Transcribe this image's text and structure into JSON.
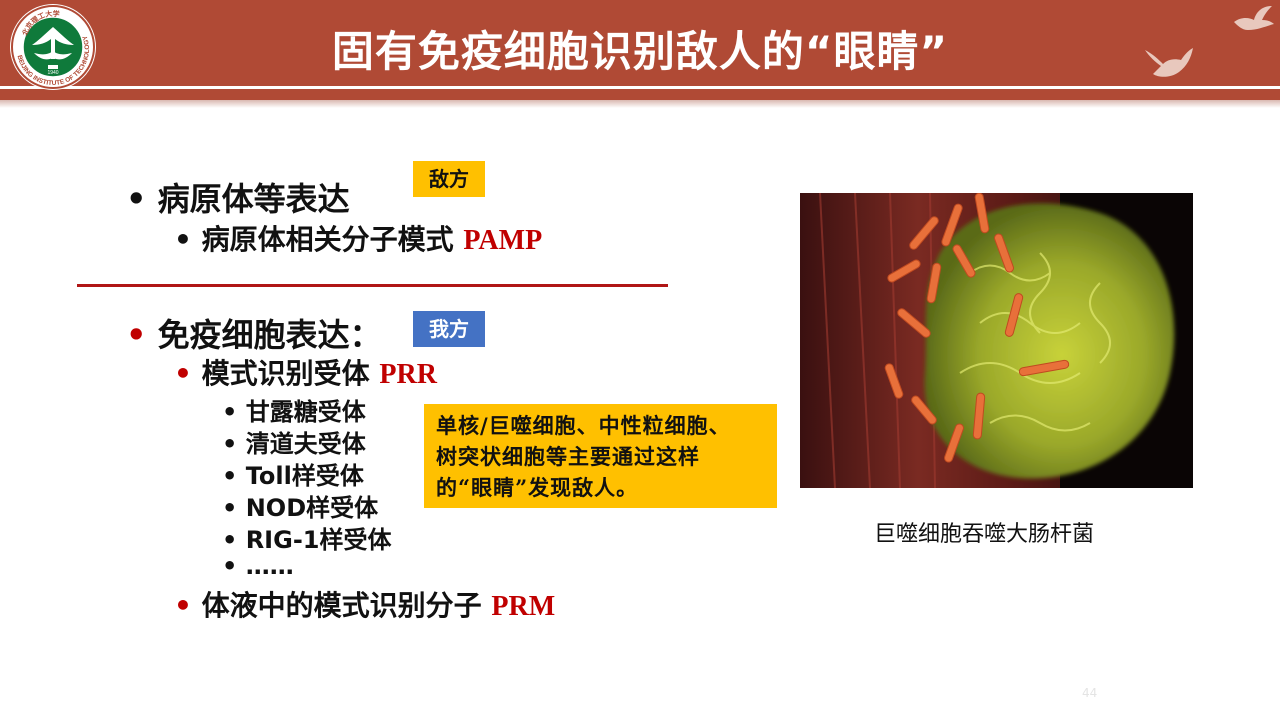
{
  "header": {
    "title": "固有免疫细胞识别敌人的“眼睛”",
    "logo_ring_text": "BEIJING INSTITUTE OF TECHNOLOGY",
    "logo_top_text": "北京理工大学",
    "logo_year": "1940"
  },
  "content": {
    "pathogen": {
      "bullet": "•",
      "heading": "病原体等表达",
      "tag": "敌方",
      "sub_bullet": "•",
      "sub_text": "病原体相关分子模式 ",
      "sub_abbr": "PAMP"
    },
    "immune": {
      "bullet": "•",
      "heading": "免疫细胞表达：",
      "tag": "我方",
      "prr_bullet": "•",
      "prr_text": "模式识别受体 ",
      "prr_abbr": "PRR",
      "receptors": [
        {
          "bullet": "•",
          "text": "甘露糖受体"
        },
        {
          "bullet": "•",
          "text": "清道夫受体"
        },
        {
          "bullet": "•",
          "text": "Toll样受体"
        },
        {
          "bullet": "•",
          "text": "NOD样受体"
        },
        {
          "bullet": "•",
          "text": "RIG-1样受体"
        },
        {
          "bullet": "•",
          "text": "……"
        }
      ],
      "prm_bullet": "•",
      "prm_text": "体液中的模式识别分子 ",
      "prm_abbr": "PRM"
    },
    "note_lines": [
      "单核/巨噬细胞、中性粒细胞、",
      "树突状细胞等主要通过这样",
      "的“眼睛”发现敌人。"
    ],
    "photo_caption": "巨噬细胞吞噬大肠杆菌",
    "page_number": "44"
  },
  "colors": {
    "header": "#b04a35",
    "accent_red": "#c00000",
    "tag_enemy": "#ffc000",
    "tag_self": "#4472c4",
    "note_bg": "#ffc000"
  }
}
